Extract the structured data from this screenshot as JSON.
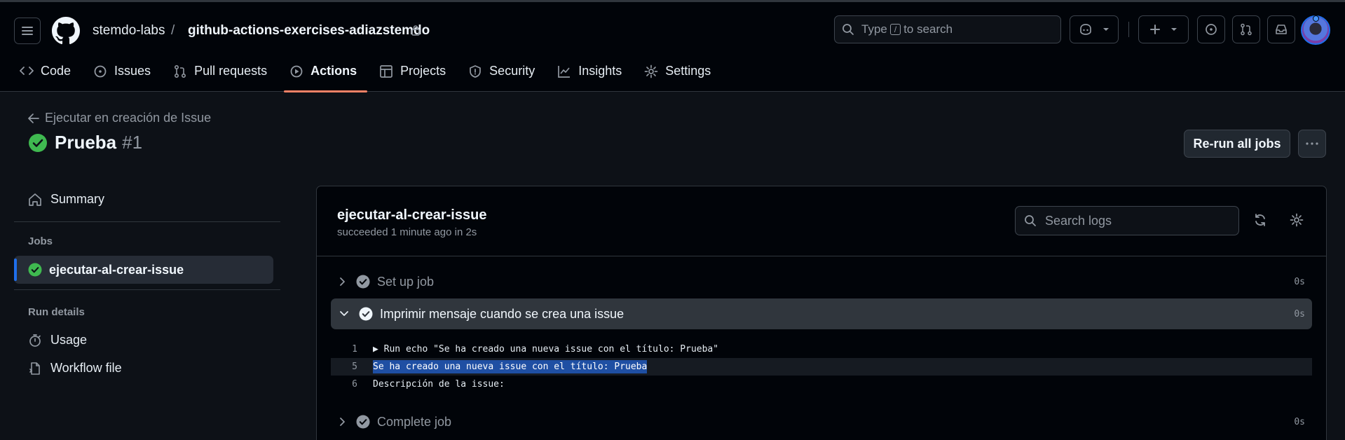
{
  "header": {
    "owner": "stemdo-labs",
    "separator": "/",
    "repo": "github-actions-exercises-adiazstemdo",
    "search": {
      "prefix": "Type",
      "key": "/",
      "suffix": "to search"
    }
  },
  "nav": {
    "tabs": [
      {
        "label": "Code",
        "icon": "code-icon"
      },
      {
        "label": "Issues",
        "icon": "issue-icon"
      },
      {
        "label": "Pull requests",
        "icon": "pull-request-icon"
      },
      {
        "label": "Actions",
        "icon": "play-icon",
        "active": true
      },
      {
        "label": "Projects",
        "icon": "table-icon"
      },
      {
        "label": "Security",
        "icon": "shield-icon"
      },
      {
        "label": "Insights",
        "icon": "graph-icon"
      },
      {
        "label": "Settings",
        "icon": "gear-icon"
      }
    ]
  },
  "run": {
    "back_label": "Ejecutar en creación de Issue",
    "title": "Prueba",
    "number": "#1",
    "rerun_label": "Re-run all jobs"
  },
  "sidebar": {
    "summary": "Summary",
    "jobs_heading": "Jobs",
    "job": "ejecutar-al-crear-issue",
    "run_details_heading": "Run details",
    "usage": "Usage",
    "workflow_file": "Workflow file"
  },
  "job": {
    "name": "ejecutar-al-crear-issue",
    "status": "succeeded 1 minute ago in 2s",
    "search_placeholder": "Search logs",
    "steps": [
      {
        "title": "Set up job",
        "duration": "0s"
      },
      {
        "title": "Imprimir mensaje cuando se crea una issue",
        "duration": "0s",
        "expanded": true
      },
      {
        "title": "Complete job",
        "duration": "0s"
      }
    ],
    "log": [
      {
        "n": "1",
        "text": "▶ Run echo \"Se ha creado una nueva issue con el título: Prueba\""
      },
      {
        "n": "5",
        "text": "Se ha creado una nueva issue con el título: Prueba",
        "selected": true
      },
      {
        "n": "6",
        "text": "Descripción de la issue:"
      }
    ]
  },
  "colors": {
    "accent_tab": "#f78166",
    "success": "#3fb950",
    "selection": "#1f4fa3",
    "sidebar_active_bar": "#1f6feb"
  }
}
